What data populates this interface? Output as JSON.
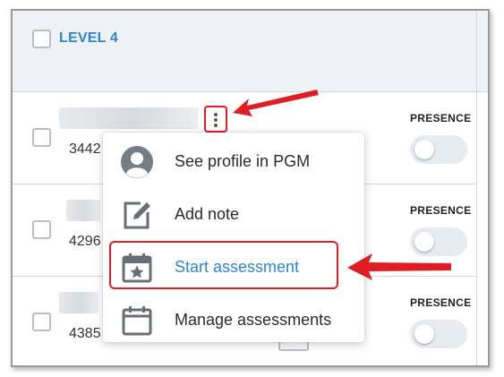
{
  "level": {
    "title": "LEVEL 4"
  },
  "rows": [
    {
      "number": "3442",
      "presence_label": "PRESENCE"
    },
    {
      "number": "4296",
      "presence_label": "PRESENCE"
    },
    {
      "number": "4385",
      "presence_label": "PRESENCE"
    }
  ],
  "menu": {
    "items": [
      {
        "label": "See profile in PGM",
        "icon": "user-avatar-icon"
      },
      {
        "label": "Add note",
        "icon": "edit-note-icon"
      },
      {
        "label": "Start assessment",
        "icon": "calendar-star-icon",
        "active": true
      },
      {
        "label": "Manage assessments",
        "icon": "calendar-icon"
      }
    ]
  },
  "colors": {
    "accent": "#2f86d0",
    "annotation_red": "#e11d24",
    "header_bg": "#eef2f7",
    "toggle_track": "#e6ebf0"
  }
}
